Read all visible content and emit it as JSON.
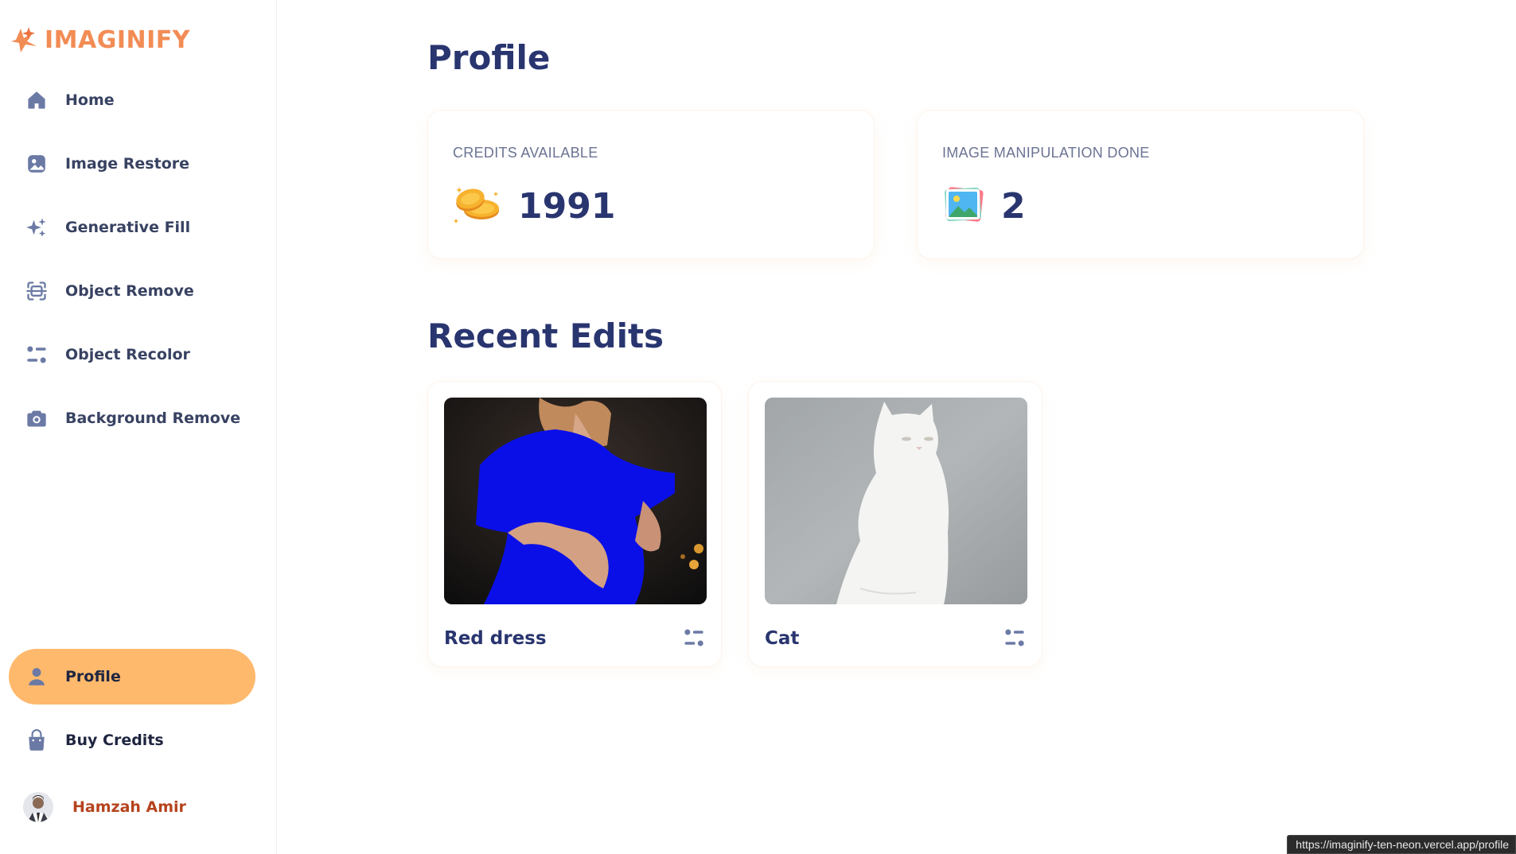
{
  "app": {
    "name": "IMAGINIFY",
    "accent": "#f28c55",
    "active_bg": "#ffb96d"
  },
  "sidebar": {
    "items": [
      {
        "label": "Home",
        "icon": "home-icon"
      },
      {
        "label": "Image Restore",
        "icon": "image-icon"
      },
      {
        "label": "Generative Fill",
        "icon": "stars-icon"
      },
      {
        "label": "Object Remove",
        "icon": "scan-icon"
      },
      {
        "label": "Object Recolor",
        "icon": "filter-icon"
      },
      {
        "label": "Background Remove",
        "icon": "camera-icon"
      }
    ],
    "bottom_items": [
      {
        "label": "Profile",
        "icon": "profile-icon",
        "active": true
      },
      {
        "label": "Buy Credits",
        "icon": "bag-icon"
      }
    ],
    "user": {
      "name": "Hamzah Amir"
    }
  },
  "main": {
    "title": "Profile",
    "stats": [
      {
        "label": "CREDITS AVAILABLE",
        "value": "1991",
        "icon": "coins-icon"
      },
      {
        "label": "IMAGE MANIPULATION DONE",
        "value": "2",
        "icon": "photo-icon"
      }
    ],
    "recent_title": "Recent Edits",
    "recent": [
      {
        "title": "Red dress",
        "icon": "filter-icon"
      },
      {
        "title": "Cat",
        "icon": "filter-icon"
      }
    ]
  },
  "status_bar": {
    "url": "https://imaginify-ten-neon.vercel.app/profile"
  }
}
